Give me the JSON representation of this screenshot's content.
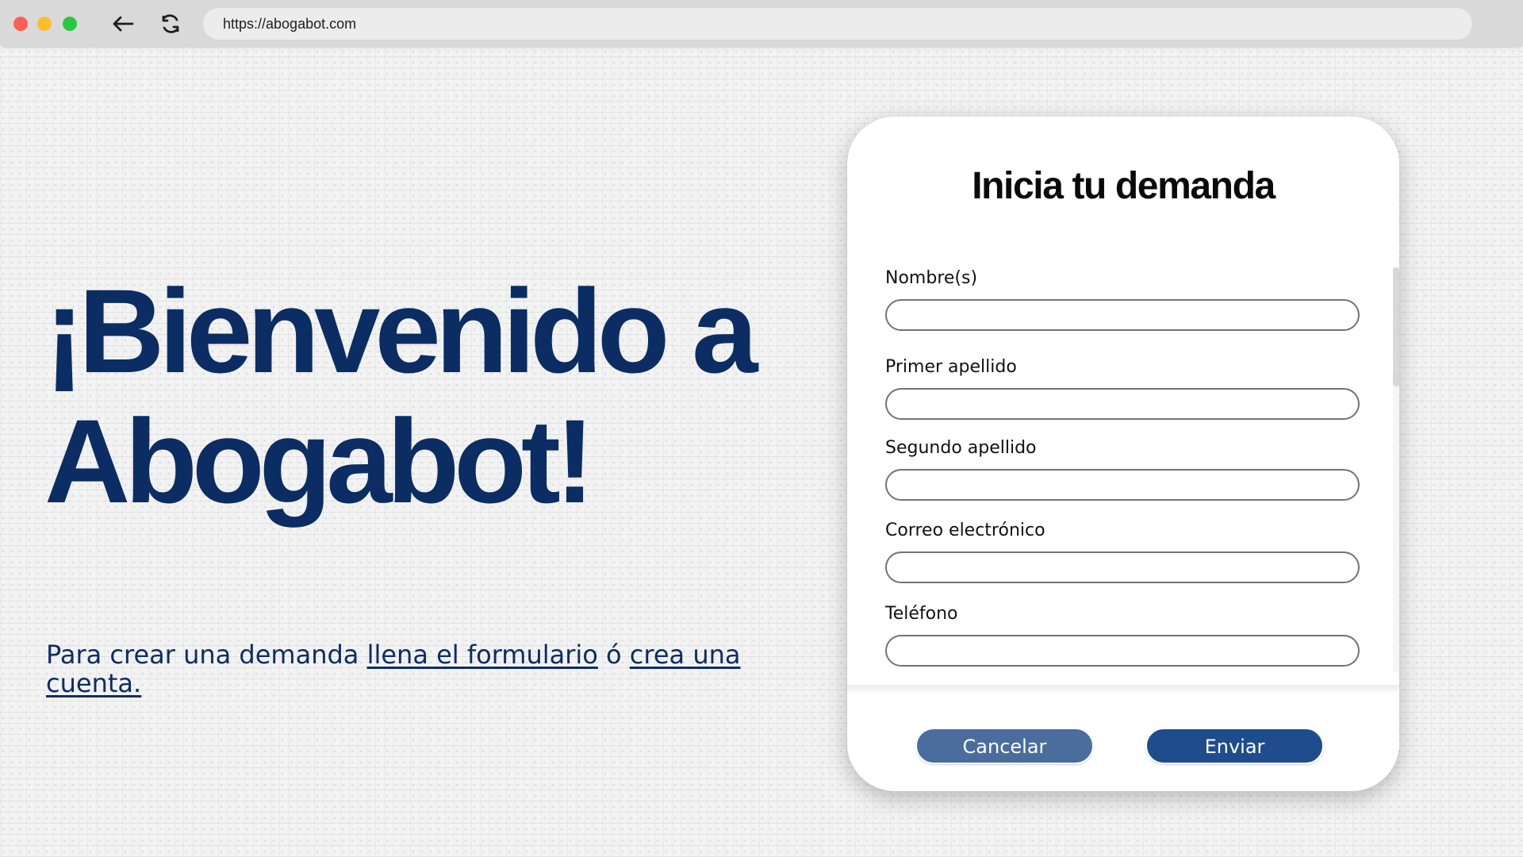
{
  "browser": {
    "url": "https://abogabot.com"
  },
  "hero": {
    "title_line1": "¡Bienvenido a",
    "title_line2": "Abogabot!",
    "subtitle_prefix": "Para crear una demanda ",
    "subtitle_link1": "llena el formulario",
    "subtitle_middle": " ó ",
    "subtitle_link2": "crea una cuenta."
  },
  "form": {
    "title": "Inicia tu demanda",
    "fields": [
      {
        "label": "Nombre(s)",
        "value": ""
      },
      {
        "label": "Primer apellido",
        "value": ""
      },
      {
        "label": "Segundo apellido",
        "value": ""
      },
      {
        "label": "Correo electrónico",
        "value": ""
      },
      {
        "label": "Teléfono",
        "value": ""
      }
    ],
    "buttons": {
      "cancel": "Cancelar",
      "send": "Enviar"
    }
  },
  "colors": {
    "brand_navy": "#0b2d63",
    "button_secondary": "#4a6d9e",
    "button_primary": "#1f4c8d",
    "input_border": "#737373"
  },
  "icons": {
    "back": "arrow-left-icon",
    "reload": "refresh-icon"
  }
}
